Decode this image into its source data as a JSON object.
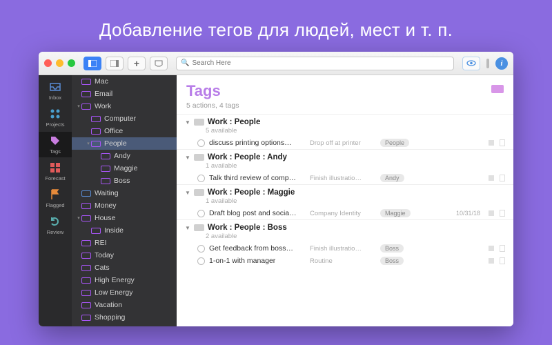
{
  "headline": "Добавление тегов для людей, мест и т. п.",
  "toolbar": {
    "search_placeholder": "Search Here"
  },
  "rail": [
    {
      "key": "inbox",
      "label": "Inbox",
      "color": "#5a8dd6"
    },
    {
      "key": "projects",
      "label": "Projects",
      "color": "#4aa0d0"
    },
    {
      "key": "tags",
      "label": "Tags",
      "color": "#c97de0",
      "active": true
    },
    {
      "key": "forecast",
      "label": "Forecast",
      "color": "#e05a5a"
    },
    {
      "key": "flagged",
      "label": "Flagged",
      "color": "#e88b3a"
    },
    {
      "key": "review",
      "label": "Review",
      "color": "#5ab0b0"
    }
  ],
  "tags": [
    {
      "label": "Mac",
      "depth": 0,
      "chev": ""
    },
    {
      "label": "Email",
      "depth": 0,
      "chev": ""
    },
    {
      "label": "Work",
      "depth": 0,
      "chev": "▾"
    },
    {
      "label": "Computer",
      "depth": 1,
      "chev": ""
    },
    {
      "label": "Office",
      "depth": 1,
      "chev": ""
    },
    {
      "label": "People",
      "depth": 1,
      "chev": "▾",
      "selected": true
    },
    {
      "label": "Andy",
      "depth": 2,
      "chev": ""
    },
    {
      "label": "Maggie",
      "depth": 2,
      "chev": ""
    },
    {
      "label": "Boss",
      "depth": 2,
      "chev": ""
    },
    {
      "label": "Waiting",
      "depth": 0,
      "chev": "",
      "paused": true
    },
    {
      "label": "Money",
      "depth": 0,
      "chev": ""
    },
    {
      "label": "House",
      "depth": 0,
      "chev": "▾"
    },
    {
      "label": "Inside",
      "depth": 1,
      "chev": ""
    },
    {
      "label": "REI",
      "depth": 0,
      "chev": ""
    },
    {
      "label": "Today",
      "depth": 0,
      "chev": ""
    },
    {
      "label": "Cats",
      "depth": 0,
      "chev": ""
    },
    {
      "label": "High Energy",
      "depth": 0,
      "chev": ""
    },
    {
      "label": "Low Energy",
      "depth": 0,
      "chev": ""
    },
    {
      "label": "Vacation",
      "depth": 0,
      "chev": ""
    },
    {
      "label": "Shopping",
      "depth": 0,
      "chev": ""
    }
  ],
  "main": {
    "title": "Tags",
    "subtitle": "5 actions, 4 tags",
    "groups": [
      {
        "title": "Work : People",
        "avail": "5 available",
        "tasks": [
          {
            "title": "discuss printing options…",
            "project": "Drop off at printer",
            "tag": "People"
          }
        ]
      },
      {
        "title": "Work : People : Andy",
        "avail": "1 available",
        "tasks": [
          {
            "title": "Talk third review of comp…",
            "project": "Finish illustratio…",
            "tag": "Andy"
          }
        ]
      },
      {
        "title": "Work : People : Maggie",
        "avail": "1 available",
        "tasks": [
          {
            "title": "Draft blog post and socia…",
            "project": "Company Identity",
            "tag": "Maggie",
            "date": "10/31/18"
          }
        ]
      },
      {
        "title": "Work : People : Boss",
        "avail": "2 available",
        "tasks": [
          {
            "title": "Get feedback from boss…",
            "project": "Finish illustratio…",
            "tag": "Boss"
          },
          {
            "title": "1-on-1 with manager",
            "project": "Routine",
            "tag": "Boss"
          }
        ]
      }
    ]
  }
}
